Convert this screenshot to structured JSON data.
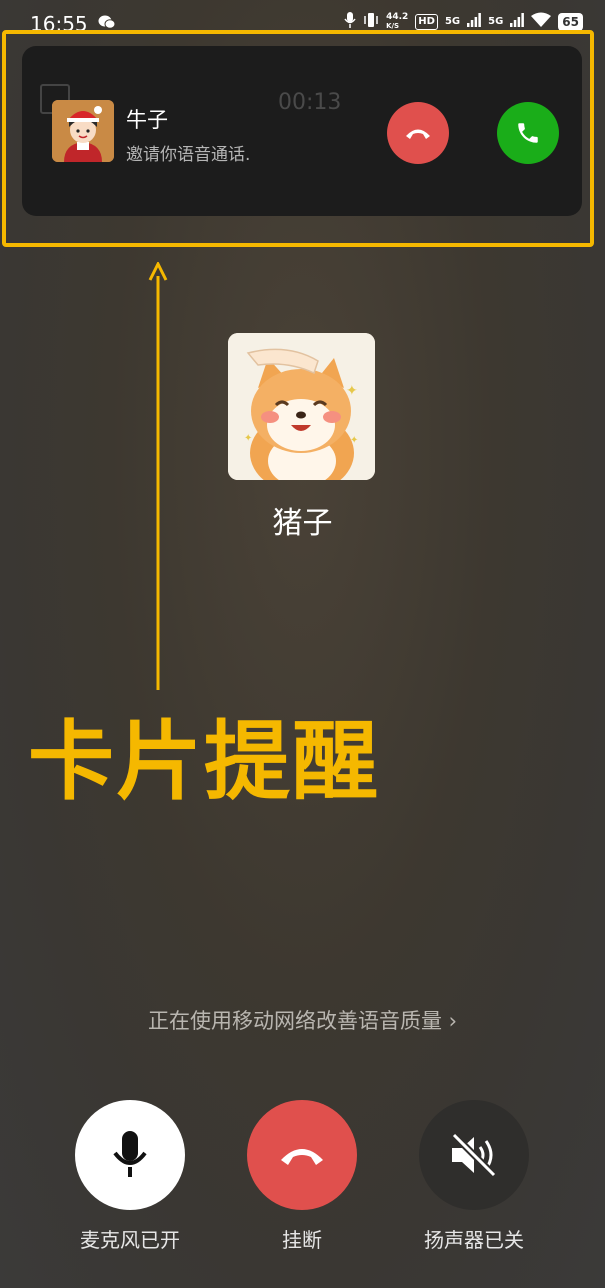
{
  "status_bar": {
    "time": "16:55",
    "net_speed": "44.2",
    "net_unit": "K/S",
    "hd": "HD",
    "sim1": "5G",
    "sim2": "5G",
    "battery": "65",
    "icons": [
      "wechat-icon",
      "mic-icon",
      "vibrate-icon",
      "signal-icon",
      "wifi-icon",
      "battery-icon"
    ]
  },
  "incoming_card": {
    "caller_name": "牛子",
    "subtitle": "邀请你语音通话.",
    "timer": "00:13",
    "decline_color": "#e0504d",
    "accept_color": "#1aad19"
  },
  "call": {
    "callee_name": "猪子",
    "network_hint": "正在使用移动网络改善语音质量 ›"
  },
  "annotation": {
    "text": "卡片提醒",
    "color": "#f5b800"
  },
  "controls": {
    "mic_label": "麦克风已开",
    "hangup_label": "挂断",
    "speaker_label": "扬声器已关"
  }
}
